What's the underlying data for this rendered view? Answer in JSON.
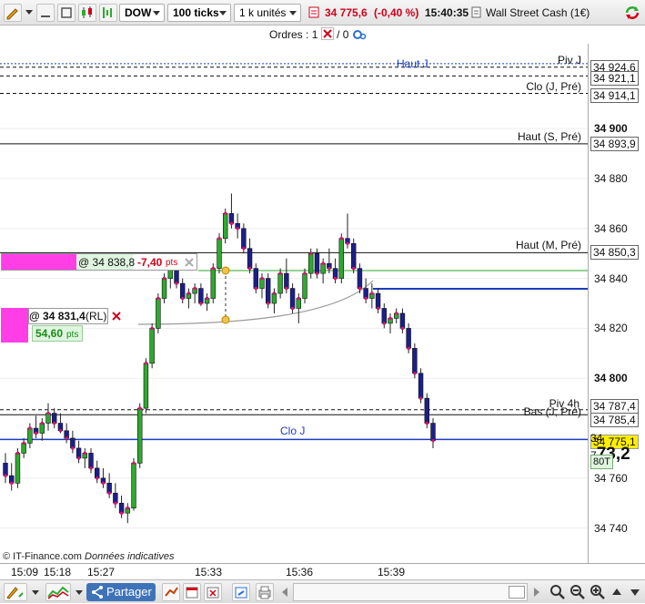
{
  "toolbar": {
    "instrument_code": "DOW",
    "ticks_label": "100 ticks",
    "units_label": "1 k unités",
    "last_price": "34 775,6",
    "change": "(-0,40 %)",
    "time": "15:40:35",
    "instrument_name": "Wall Street Cash (1€)"
  },
  "orders": {
    "label": "Ordres :",
    "count_a": "1",
    "separator": "/",
    "count_b": "0"
  },
  "price_axis": {
    "ticks": [
      {
        "label": "34 900",
        "value": 34900
      },
      {
        "label": "34 880",
        "value": 34880
      },
      {
        "label": "34 860",
        "value": 34860
      },
      {
        "label": "34 840",
        "value": 34840
      },
      {
        "label": "34 820",
        "value": 34820
      },
      {
        "label": "34 800",
        "value": 34800
      },
      {
        "label": "34 760",
        "value": 34760
      },
      {
        "label": "34 740",
        "value": 34740
      }
    ],
    "level_boxes": [
      {
        "label": "34 924,6",
        "value": 34924.6
      },
      {
        "label": "34 921,1",
        "value": 34921.1
      },
      {
        "label": "34 914,1",
        "value": 34914.1
      },
      {
        "label": "34 893,9",
        "value": 34893.9
      },
      {
        "label": "34 850,3",
        "value": 34850.3
      },
      {
        "label": "34 787,4",
        "value": 34787.4
      },
      {
        "label": "34 785,4",
        "value": 34785.4
      }
    ],
    "current_box": {
      "label": "34 775,1",
      "value": 34775.1
    },
    "big_price_prefix": "34 7",
    "big_price_suffix": "73,2",
    "volume_badge": "80T"
  },
  "levels": [
    {
      "label": "Haut J",
      "value": 34926,
      "style": "dotted",
      "color": "#1b3dbd"
    },
    {
      "label": "Piv J",
      "value": 34924.6,
      "style": "dashed",
      "color": "#111111"
    },
    {
      "label": "",
      "value": 34921.1,
      "style": "dashed",
      "color": "#111111"
    },
    {
      "label": "Clo (J, Pré)",
      "value": 34914.1,
      "style": "dashed",
      "color": "#111111"
    },
    {
      "label": "Haut (S, Pré)",
      "value": 34893.9,
      "style": "solid",
      "color": "#111111"
    },
    {
      "label": "Haut (M, Pré)",
      "value": 34850.3,
      "style": "solid",
      "color": "#111111"
    },
    {
      "label": "Piv 4h",
      "value": 34787.4,
      "style": "dashed",
      "color": "#111111"
    },
    {
      "label": "Bas (J, Pré)",
      "value": 34785.4,
      "style": "solid",
      "color": "#111111"
    },
    {
      "label": "Clo J",
      "value": 34775.5,
      "style": "solid",
      "color": "#1b3dbd"
    }
  ],
  "order_tags": {
    "stop": {
      "price": "@ 34 838,8",
      "pnl": "-7,40",
      "pnl_unit": "pts"
    },
    "position": {
      "price": "@ 34 831,4",
      "tag": "(RL)",
      "pnl": "54,60",
      "pnl_unit": "pts"
    }
  },
  "time_axis": {
    "labels": [
      "15:09",
      "15:18",
      "15:27",
      "15:33",
      "15:36",
      "15:39"
    ]
  },
  "copyright": {
    "brand": "© IT-Finance.com",
    "note": "Données indicatives"
  },
  "bottombar": {
    "share_label": "Partager"
  },
  "colors": {
    "bull": "#2eaa2e",
    "bear": "#1c1f8a",
    "marker": "#e0106e",
    "accent_blue": "#1b3dbd",
    "negative": "#d0021b",
    "magenta": "#ff3ee6",
    "yellow": "#ffee00"
  },
  "chart_data": {
    "type": "candlestick",
    "ylim": [
      34726,
      34934
    ],
    "candles": [
      [
        34766,
        34770,
        34758,
        34761
      ],
      [
        34761,
        34766,
        34755,
        34758
      ],
      [
        34758,
        34772,
        34756,
        34770
      ],
      [
        34770,
        34776,
        34768,
        34774
      ],
      [
        34774,
        34782,
        34772,
        34780
      ],
      [
        34780,
        34785,
        34776,
        34778
      ],
      [
        34778,
        34784,
        34775,
        34782
      ],
      [
        34782,
        34790,
        34779,
        34786
      ],
      [
        34786,
        34788,
        34780,
        34782
      ],
      [
        34782,
        34786,
        34778,
        34779
      ],
      [
        34779,
        34782,
        34774,
        34776
      ],
      [
        34776,
        34779,
        34770,
        34772
      ],
      [
        34772,
        34775,
        34766,
        34768
      ],
      [
        34768,
        34772,
        34764,
        34770
      ],
      [
        34770,
        34772,
        34762,
        34764
      ],
      [
        34764,
        34767,
        34758,
        34760
      ],
      [
        34760,
        34764,
        34756,
        34758
      ],
      [
        34758,
        34762,
        34752,
        34754
      ],
      [
        34754,
        34758,
        34748,
        34750
      ],
      [
        34750,
        34753,
        34744,
        34746
      ],
      [
        34746,
        34750,
        34742,
        34748
      ],
      [
        34748,
        34768,
        34747,
        34766
      ],
      [
        34766,
        34790,
        34764,
        34788
      ],
      [
        34788,
        34808,
        34786,
        34806
      ],
      [
        34806,
        34822,
        34804,
        34820
      ],
      [
        34820,
        34834,
        34818,
        34832
      ],
      [
        34832,
        34842,
        34830,
        34840
      ],
      [
        34840,
        34846,
        34836,
        34844
      ],
      [
        34844,
        34846,
        34836,
        34838
      ],
      [
        34838,
        34840,
        34830,
        34832
      ],
      [
        34832,
        34836,
        34828,
        34834
      ],
      [
        34834,
        34838,
        34830,
        34836
      ],
      [
        34836,
        34838,
        34829,
        34830
      ],
      [
        34830,
        34834,
        34827,
        34832
      ],
      [
        34832,
        34846,
        34830,
        34844
      ],
      [
        34844,
        34858,
        34842,
        34856
      ],
      [
        34856,
        34868,
        34854,
        34866
      ],
      [
        34866,
        34874,
        34860,
        34862
      ],
      [
        34862,
        34866,
        34856,
        34860
      ],
      [
        34860,
        34862,
        34850,
        34852
      ],
      [
        34852,
        34856,
        34842,
        34844
      ],
      [
        34844,
        34846,
        34834,
        34836
      ],
      [
        34836,
        34842,
        34832,
        34840
      ],
      [
        34840,
        34842,
        34828,
        34830
      ],
      [
        34830,
        34836,
        34826,
        34834
      ],
      [
        34834,
        34844,
        34832,
        34842
      ],
      [
        34842,
        34848,
        34834,
        34836
      ],
      [
        34836,
        34838,
        34826,
        34828
      ],
      [
        34828,
        34834,
        34822,
        34832
      ],
      [
        34832,
        34844,
        34830,
        34842
      ],
      [
        34842,
        34852,
        34840,
        34850
      ],
      [
        34850,
        34852,
        34840,
        34842
      ],
      [
        34842,
        34848,
        34838,
        34846
      ],
      [
        34846,
        34852,
        34842,
        34844
      ],
      [
        34844,
        34848,
        34838,
        34840
      ],
      [
        34840,
        34858,
        34838,
        34856
      ],
      [
        34856,
        34866,
        34852,
        34854
      ],
      [
        34854,
        34856,
        34842,
        34844
      ],
      [
        34844,
        34846,
        34834,
        34836
      ],
      [
        34836,
        34840,
        34830,
        34832
      ],
      [
        34832,
        34838,
        34828,
        34834
      ],
      [
        34834,
        34836,
        34826,
        34828
      ],
      [
        34828,
        34830,
        34820,
        34822
      ],
      [
        34822,
        34826,
        34818,
        34824
      ],
      [
        34824,
        34828,
        34822,
        34826
      ],
      [
        34826,
        34828,
        34818,
        34820
      ],
      [
        34820,
        34822,
        34810,
        34812
      ],
      [
        34812,
        34814,
        34800,
        34802
      ],
      [
        34802,
        34804,
        34790,
        34792
      ],
      [
        34792,
        34794,
        34780,
        34782
      ],
      [
        34782,
        34784,
        34772,
        34775
      ]
    ]
  }
}
